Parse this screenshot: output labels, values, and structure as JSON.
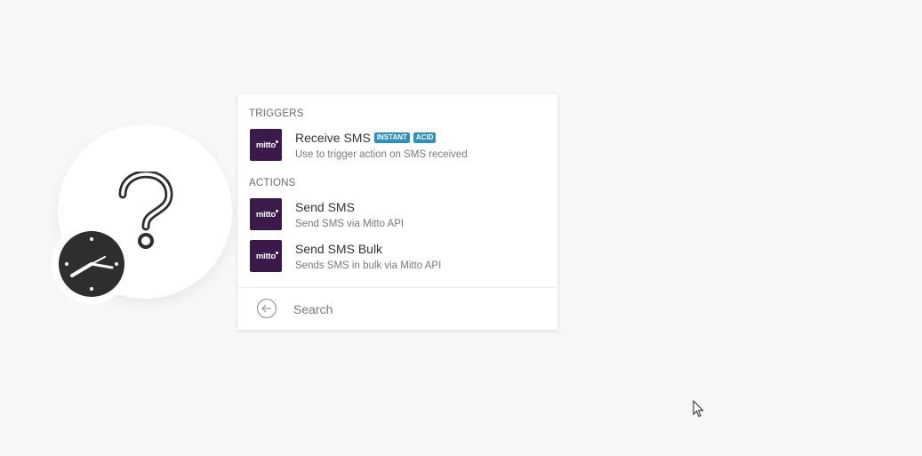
{
  "colors": {
    "background": "#f7f7f7",
    "mitto_logo_bg": "#3a1a4a",
    "badge_bg": "#2f8fbf",
    "clock_face": "#2e2e2e"
  },
  "module": {
    "placeholder_icon": "question-mark-icon",
    "trigger_icon": "clock-icon"
  },
  "panel": {
    "triggers_title": "TRIGGERS",
    "actions_title": "ACTIONS",
    "triggers": [
      {
        "logo": "mitto",
        "title": "Receive SMS",
        "badges": [
          "INSTANT",
          "ACID"
        ],
        "description": "Use to trigger action on SMS received"
      }
    ],
    "actions": [
      {
        "logo": "mitto",
        "title": "Send SMS",
        "description": "Send SMS via Mitto API"
      },
      {
        "logo": "mitto",
        "title": "Send SMS Bulk",
        "description": "Sends SMS in bulk via Mitto API"
      }
    ],
    "search": {
      "back_icon": "arrow-left-circle-icon",
      "placeholder": "Search",
      "value": ""
    }
  }
}
